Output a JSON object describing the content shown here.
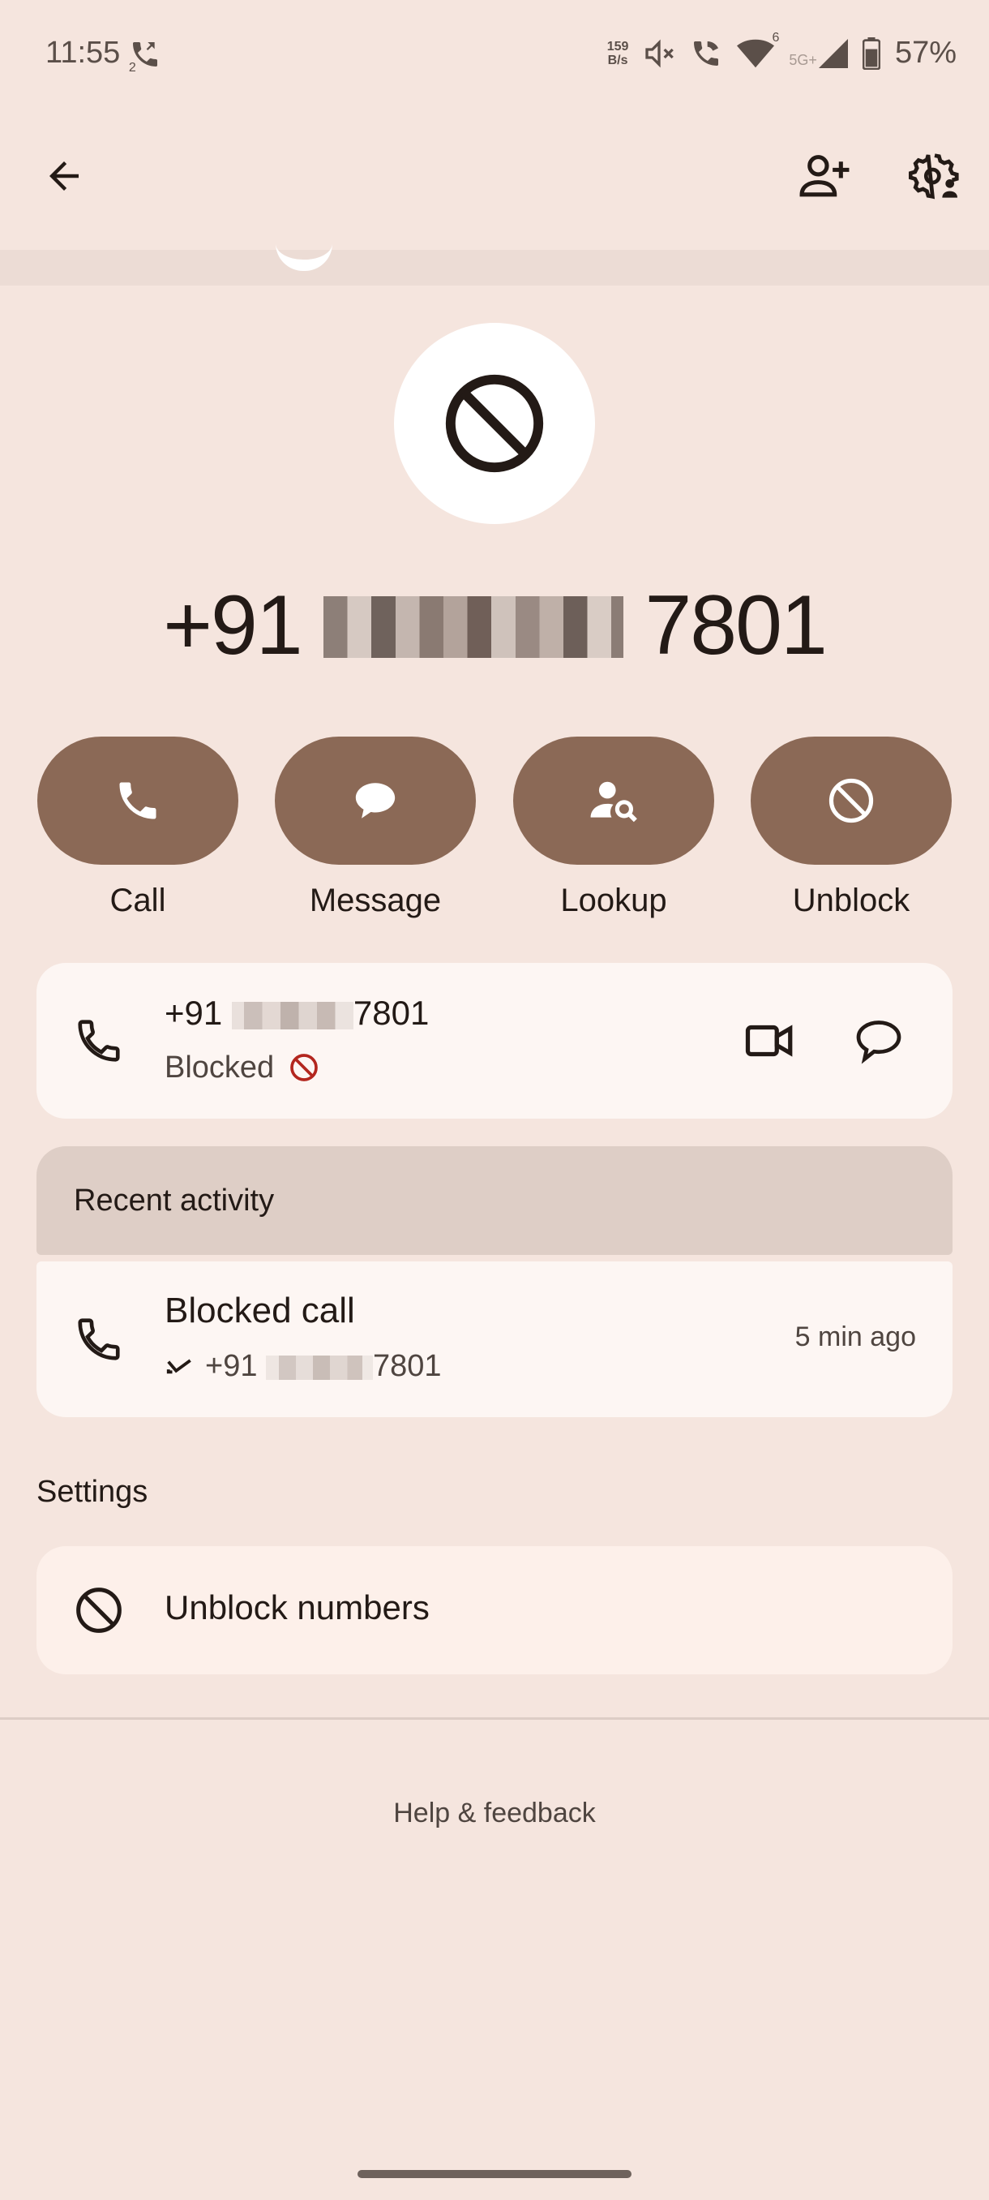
{
  "status_bar": {
    "time": "11:55",
    "call_forward_badge": "2",
    "net_speed_value": "159",
    "net_speed_unit": "B/s",
    "wifi_badge": "6",
    "network_type": "5G+",
    "battery": "57%"
  },
  "contact": {
    "number_prefix": "+91",
    "number_suffix": "7801"
  },
  "actions": [
    {
      "label": "Call",
      "icon": "phone-icon"
    },
    {
      "label": "Message",
      "icon": "message-icon"
    },
    {
      "label": "Lookup",
      "icon": "lookup-icon"
    },
    {
      "label": "Unblock",
      "icon": "block-icon"
    }
  ],
  "number_card": {
    "prefix": "+91",
    "suffix": "7801",
    "status": "Blocked"
  },
  "recent_activity": {
    "title": "Recent activity",
    "entry_title": "Blocked call",
    "entry_prefix": "+91",
    "entry_suffix": "7801",
    "entry_time": "5 min ago"
  },
  "settings": {
    "title": "Settings",
    "unblock_label": "Unblock numbers"
  },
  "footer": {
    "help": "Help & feedback"
  },
  "colors": {
    "background": "#f5e5de",
    "accent_button": "#8b6956",
    "card": "#fdf6f3",
    "blocked_red": "#b3261e"
  }
}
